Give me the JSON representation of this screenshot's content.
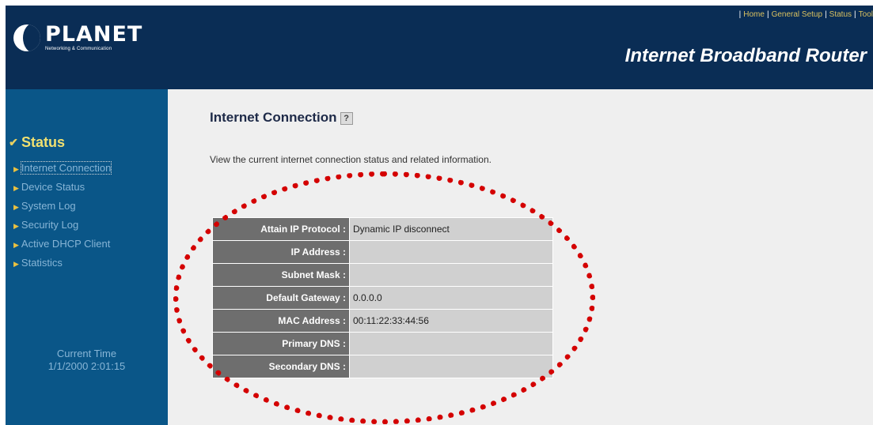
{
  "header": {
    "logo_name": "PLANET",
    "logo_tagline": "Networking & Communication",
    "product_title": "Internet Broadband Router",
    "nav": [
      "Home",
      "General Setup",
      "Status",
      "Tool"
    ]
  },
  "sidebar": {
    "section_title": "Status",
    "items": [
      {
        "label": "Internet Connection",
        "active": true
      },
      {
        "label": "Device Status"
      },
      {
        "label": "System Log"
      },
      {
        "label": "Security Log"
      },
      {
        "label": "Active DHCP Client"
      },
      {
        "label": "Statistics"
      }
    ],
    "clock_label": "Current Time",
    "clock_value": "1/1/2000 2:01:15"
  },
  "main": {
    "title": "Internet Connection",
    "description": "View the current internet connection status and related information.",
    "rows": [
      {
        "label": "Attain IP Protocol :",
        "value": "Dynamic IP disconnect"
      },
      {
        "label": "IP Address :",
        "value": ""
      },
      {
        "label": "Subnet Mask :",
        "value": ""
      },
      {
        "label": "Default Gateway :",
        "value": "0.0.0.0"
      },
      {
        "label": "MAC Address :",
        "value": "00:11:22:33:44:56"
      },
      {
        "label": "Primary DNS :",
        "value": ""
      },
      {
        "label": "Secondary DNS :",
        "value": ""
      }
    ]
  },
  "annotation": {
    "color": "#d40000"
  }
}
